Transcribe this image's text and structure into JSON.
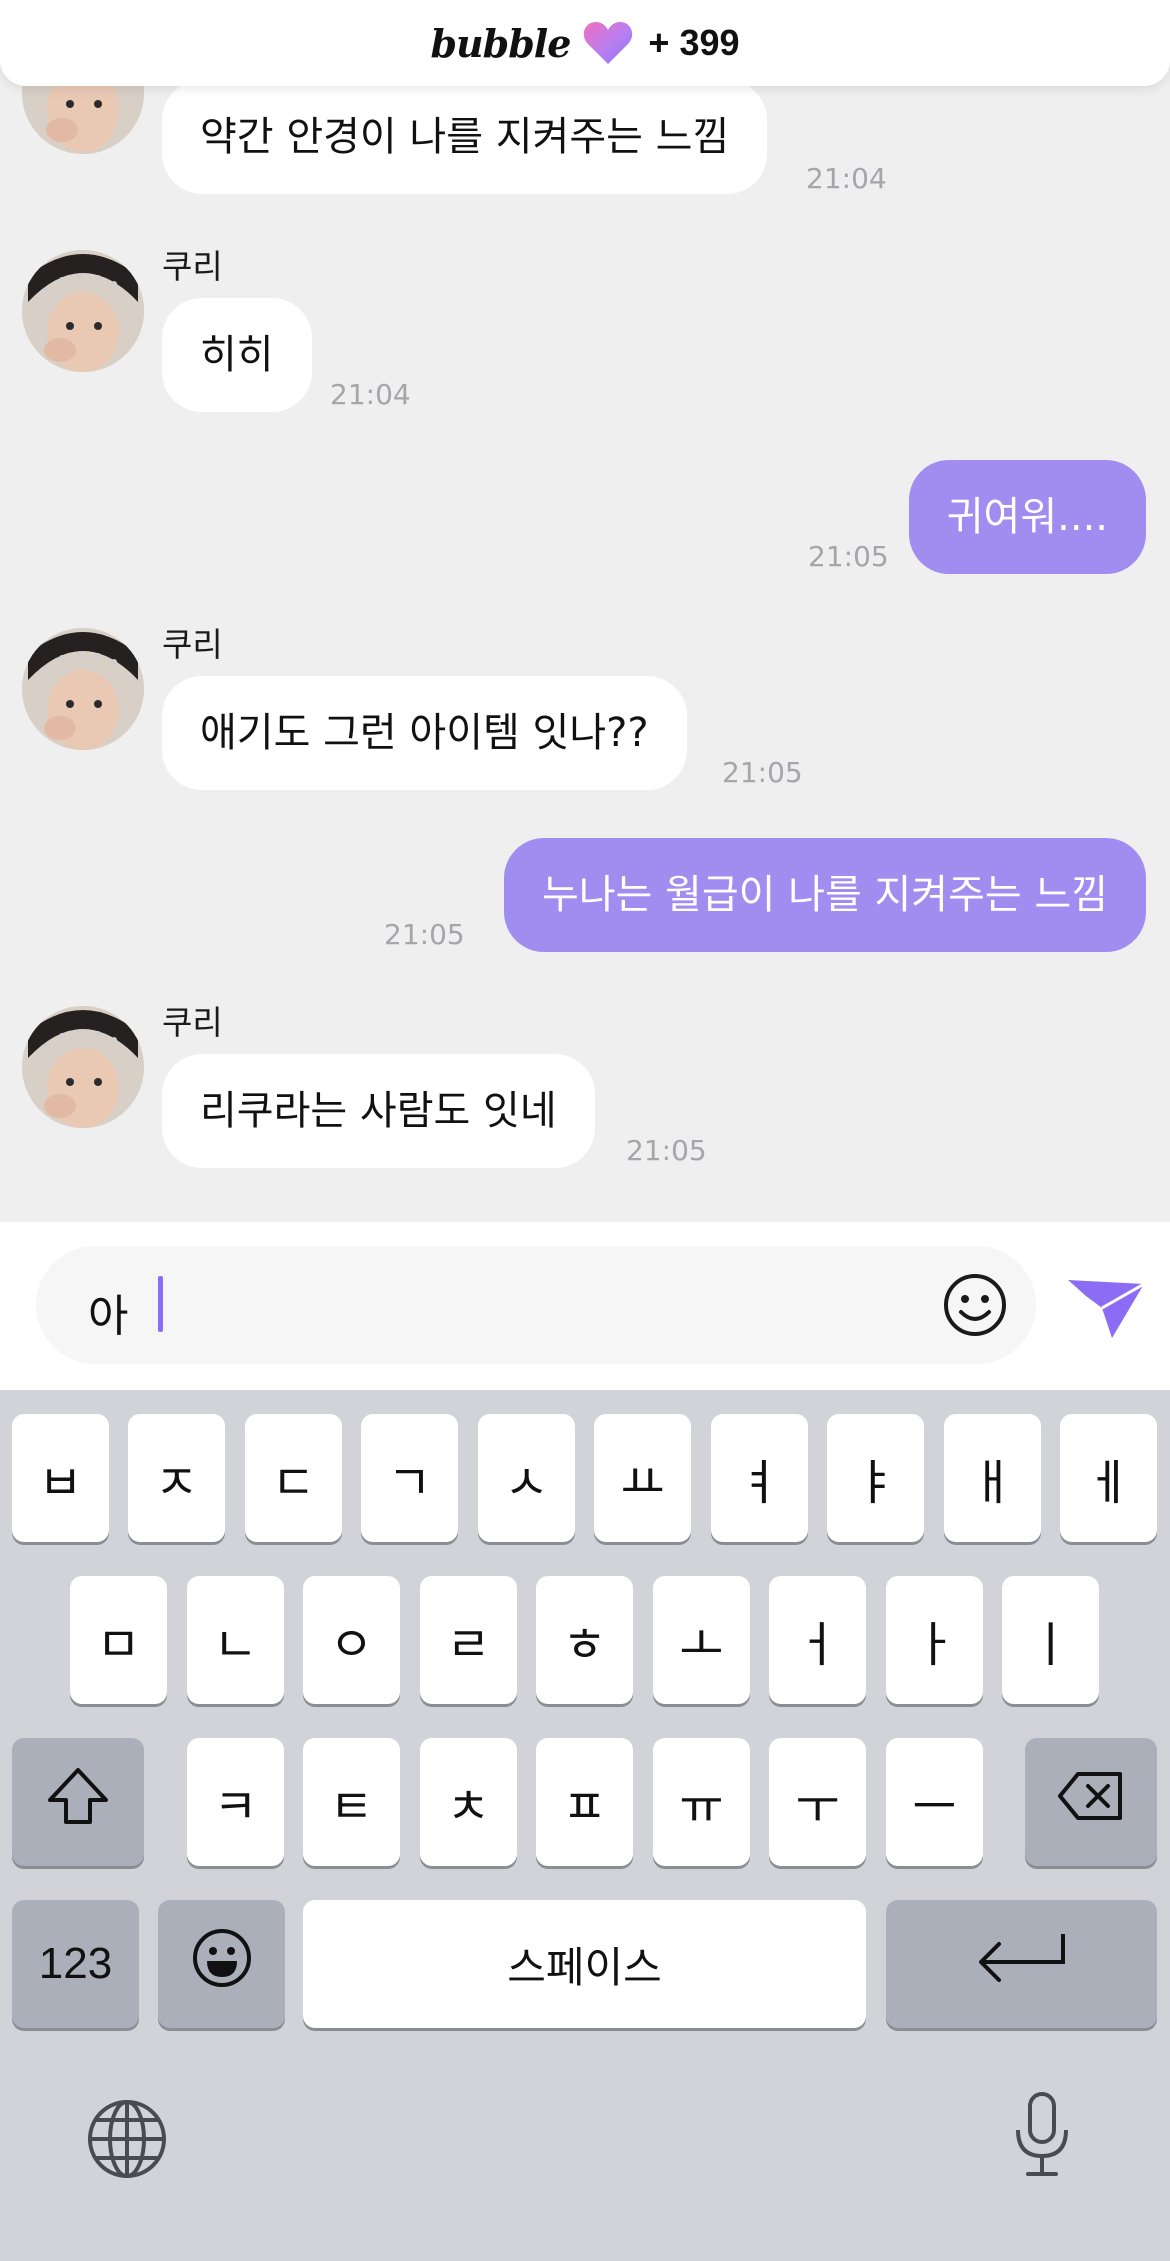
{
  "header": {
    "brand": "bubble",
    "count": "+ 399"
  },
  "messages": [
    {
      "type": "in",
      "text": "약간 안경이 나를 지켜주는 느낌",
      "time": "21:04",
      "sender": ""
    },
    {
      "type": "in",
      "text": "히히",
      "time": "21:04",
      "sender": "쿠리"
    },
    {
      "type": "out",
      "text": "귀여워....",
      "time": "21:05"
    },
    {
      "type": "in",
      "text": "애기도 그런 아이템 잇나??",
      "time": "21:05",
      "sender": "쿠리"
    },
    {
      "type": "out",
      "text": "누나는 월급이 나를 지켜주는 느낌",
      "time": "21:05"
    },
    {
      "type": "in",
      "text": "리쿠라는 사람도 잇네",
      "time": "21:05",
      "sender": "쿠리"
    }
  ],
  "input": {
    "value": "아"
  },
  "keyboard": {
    "row1": [
      "ㅂ",
      "ㅈ",
      "ㄷ",
      "ㄱ",
      "ㅅ",
      "ㅛ",
      "ㅕ",
      "ㅑ",
      "ㅐ",
      "ㅔ"
    ],
    "row2": [
      "ㅁ",
      "ㄴ",
      "ㅇ",
      "ㄹ",
      "ㅎ",
      "ㅗ",
      "ㅓ",
      "ㅏ",
      "ㅣ"
    ],
    "row3": [
      "ㅋ",
      "ㅌ",
      "ㅊ",
      "ㅍ",
      "ㅠ",
      "ㅜ",
      "ㅡ"
    ],
    "num_label": "123",
    "space_label": "스페이스"
  },
  "colors": {
    "accent": "#8c6cf4",
    "outgoing_bubble": "#a18cef",
    "incoming_bubble": "#ffffff",
    "chat_background": "#efeff0",
    "keyboard_background": "#d1d3d9"
  },
  "icons": {
    "header": "heart-icon",
    "input": "smiley-icon",
    "send": "send-icon",
    "keyboard": [
      "shift-icon",
      "backspace-icon",
      "emoji-icon",
      "return-icon",
      "globe-icon",
      "microphone-icon"
    ]
  }
}
